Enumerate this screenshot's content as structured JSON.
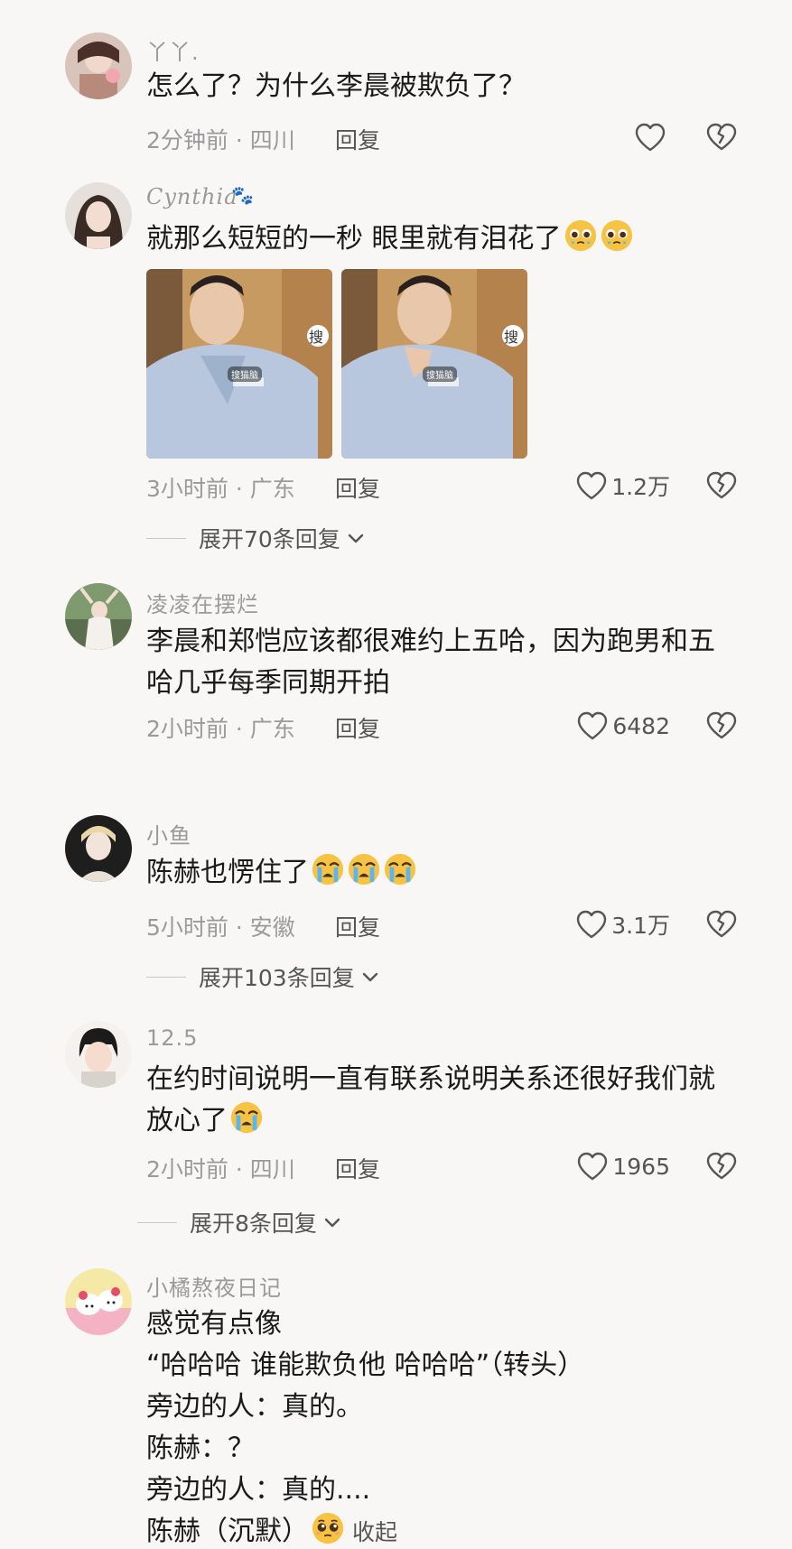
{
  "comments": [
    {
      "username": "丫丫.",
      "lines": [
        "怎么了？为什么李晨被欺负了？"
      ],
      "time": "2分钟前",
      "location": "四川",
      "reply_label": "回复",
      "likes": ""
    },
    {
      "username": "Cynthia",
      "lines": [
        "就那么短短的一秒 眼里就有泪花了"
      ],
      "time": "3小时前",
      "location": "广东",
      "reply_label": "回复",
      "likes": "1.2万",
      "expand_label": "展开70条回复"
    },
    {
      "username": "凌凌在摆烂",
      "lines": [
        "李晨和郑恺应该都很难约上五哈，因为跑男和五",
        "哈几乎每季同期开拍"
      ],
      "time": "2小时前",
      "location": "广东",
      "reply_label": "回复",
      "likes": "6482"
    },
    {
      "username": "小鱼",
      "lines": [
        "陈赫也愣住了"
      ],
      "time": "5小时前",
      "location": "安徽",
      "reply_label": "回复",
      "likes": "3.1万",
      "expand_label": "展开103条回复"
    },
    {
      "username": "12.5",
      "lines": [
        "在约时间说明一直有联系说明关系还很好我们就",
        "放心了"
      ],
      "time": "2小时前",
      "location": "四川",
      "reply_label": "回复",
      "likes": "1965",
      "expand_label": "展开8条回复"
    },
    {
      "username": "小橘熬夜日记",
      "lines": [
        "感觉有点像",
        "“哈哈哈 谁能欺负他 哈哈哈”（转头）",
        "旁边的人：真的。",
        "陈赫：？",
        "旁边的人：真的....",
        "陈赫（沉默）"
      ],
      "collapse_label": "收起"
    }
  ],
  "thumbnails": [
    {
      "sticker": "搜",
      "caption": "搜猫脑"
    },
    {
      "sticker": "搜",
      "caption": "搜猫脑"
    }
  ],
  "separator": "·",
  "icons": {
    "like": "heart-outline-icon",
    "dislike": "broken-heart-icon",
    "expand": "chevron-down-icon"
  },
  "colors": {
    "background": "#f8f7f6",
    "text_primary": "#1a1a1a",
    "text_secondary": "#9a9a9a",
    "emoji_yellow": "#f6c343"
  }
}
